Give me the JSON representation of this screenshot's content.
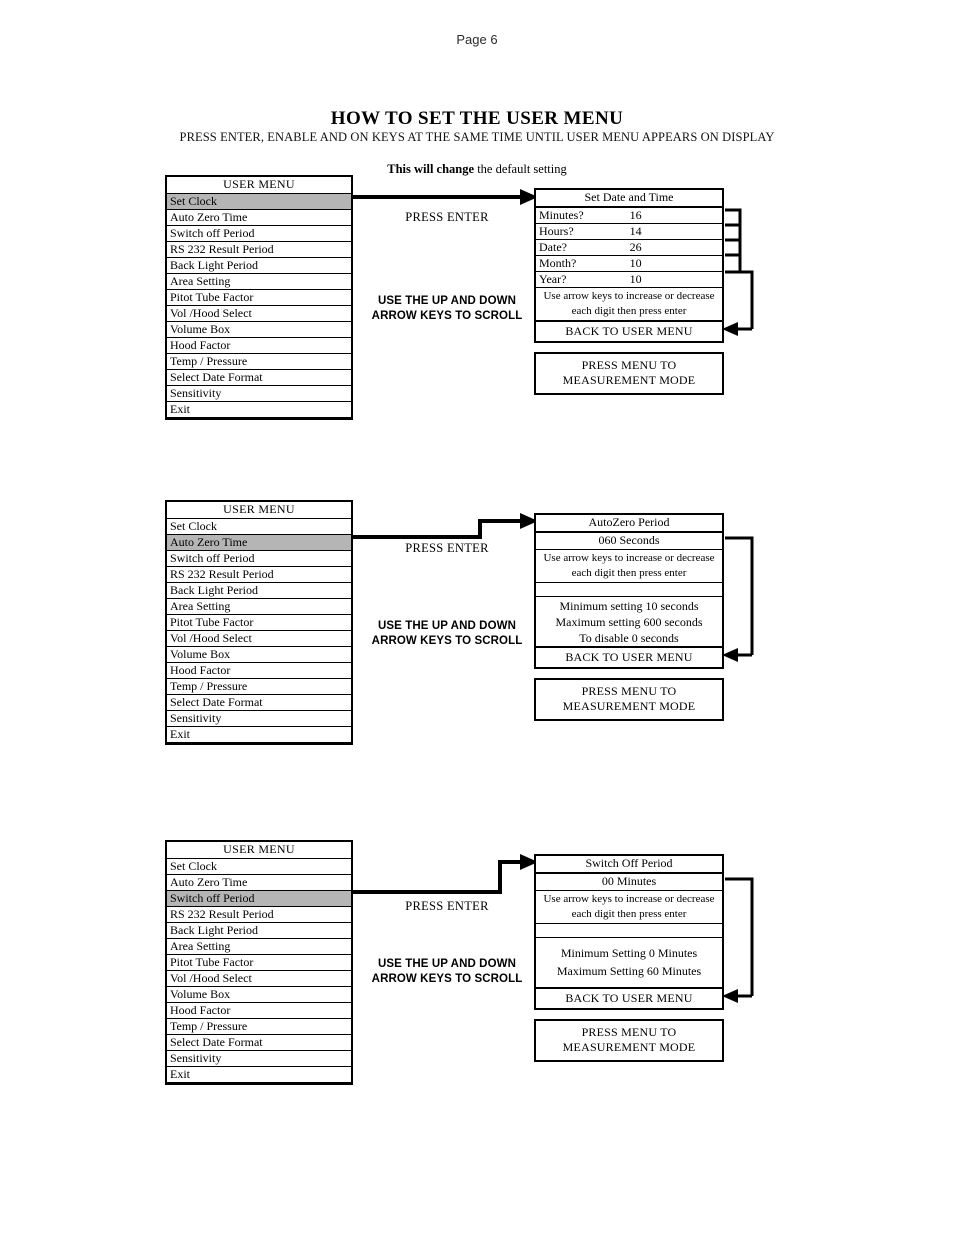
{
  "page": {
    "page_label": "Page 6",
    "title": "HOW TO SET THE USER MENU",
    "subtitle": "PRESS ENTER, ENABLE AND ON KEYS AT THE SAME TIME UNTIL USER MENU APPEARS ON DISPLAY",
    "note_bold": "This will change",
    "note_rest": " the default setting"
  },
  "labels": {
    "press_enter": "PRESS ENTER",
    "scroll_line1": "USE THE UP AND DOWN",
    "scroll_line2": "ARROW KEYS TO SCROLL",
    "back_to_user_menu": "BACK TO USER MENU",
    "mode_line1": "PRESS MENU TO",
    "mode_line2": "MEASUREMENT MODE",
    "arrow_help_line1": "Use arrow keys to increase or decrease",
    "arrow_help_line2": "each digit then press enter"
  },
  "colors": {
    "selected_row": "#b5b5b5",
    "border": "#000000",
    "background": "#ffffff"
  },
  "menu": {
    "header": "USER MENU",
    "items": [
      "Set Clock",
      "Auto Zero Time",
      "Switch off Period",
      "RS 232 Result Period",
      "Back Light Period",
      "Area Setting",
      "Pitot Tube Factor",
      "Vol /Hood Select",
      "Volume Box",
      "Hood Factor",
      "Temp / Pressure",
      "Select Date Format",
      "Sensitivity",
      "Exit"
    ]
  },
  "sections": [
    {
      "id": "set-clock",
      "selected_index": 0,
      "selected_label": "Set Clock",
      "panel": {
        "header": "Set Date and Time",
        "fields": [
          {
            "label": "Minutes?",
            "value": "16"
          },
          {
            "label": "Hours?",
            "value": "14"
          },
          {
            "label": "Date?",
            "value": "26"
          },
          {
            "label": "Month?",
            "value": "10"
          },
          {
            "label": "Year?",
            "value": "10"
          }
        ]
      }
    },
    {
      "id": "auto-zero-time",
      "selected_index": 1,
      "selected_label": "Auto Zero Time",
      "panel": {
        "header": "AutoZero Period",
        "value": "060 Seconds",
        "limits": [
          "Minimum setting 10 seconds",
          "Maximum setting 600 seconds",
          "To disable 0 seconds"
        ]
      }
    },
    {
      "id": "switch-off-period",
      "selected_index": 2,
      "selected_label": "Switch off Period",
      "panel": {
        "header": "Switch Off Period",
        "value": "00 Minutes",
        "limits": [
          "Minimum Setting 0 Minutes",
          "Maximum Setting 60 Minutes"
        ]
      }
    }
  ]
}
